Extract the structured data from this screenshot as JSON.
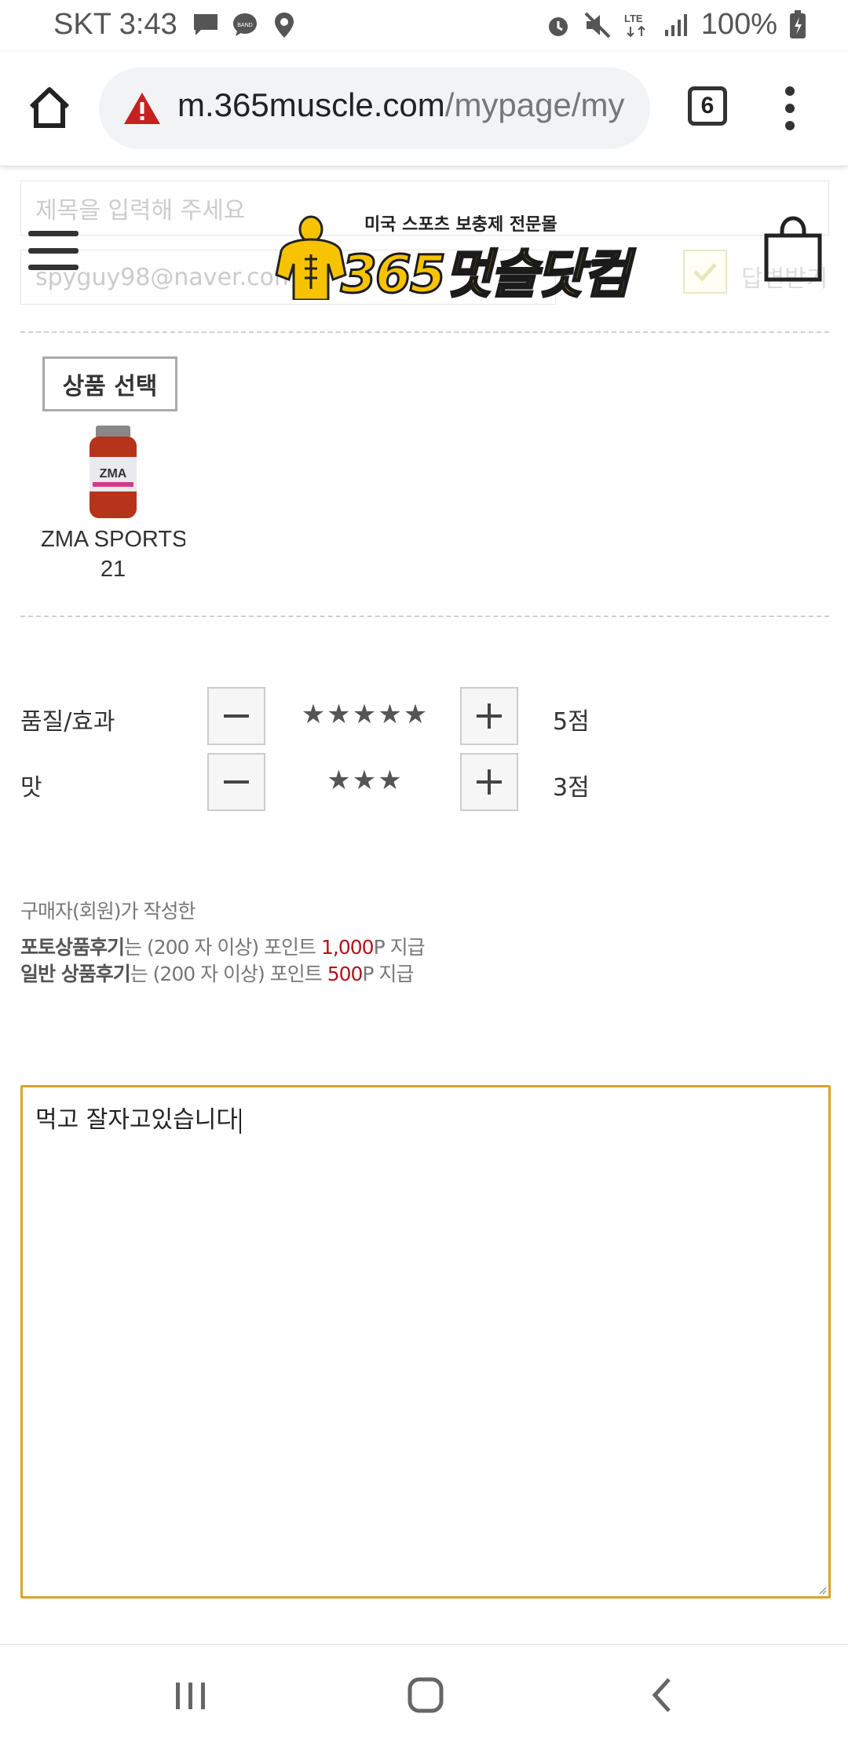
{
  "status_bar": {
    "carrier_time": "SKT 3:43",
    "notification_icons": [
      "message-icon",
      "band-icon",
      "location-icon"
    ],
    "band_label": "BAND",
    "system_icons": [
      "alarm-icon",
      "mute-icon",
      "lte-icon",
      "signal-icon"
    ],
    "lte_label": "LTE",
    "battery": "100%"
  },
  "browser": {
    "url_host": "m.365muscle.com",
    "url_path": "/mypage/my",
    "tab_count": "6",
    "security_state": "not-secure"
  },
  "site": {
    "logo_tagline": "미국 스포츠 보충제 전문몰",
    "logo_brand": "365멋슬닷컴"
  },
  "form": {
    "title_placeholder": "제목을 입력해 주세요",
    "email_value": "spyguy98@naver.com",
    "reply_checkbox_label": "답변받기",
    "product_select_label": "상품 선택",
    "product_name": "ZMA SPORTS",
    "product_name_line2": "21",
    "ratings": [
      {
        "label": "품질/효과",
        "stars": "★★★★★",
        "score": "5점",
        "value": 5
      },
      {
        "label": "맛",
        "stars": "★★★",
        "score": "3점",
        "value": 3
      }
    ],
    "notice": {
      "line1": "구매자(회원)가 작성한",
      "line2_bold": "포토상품후기",
      "line2_mid": "는 (200 자 이상) 포인트 ",
      "line2_points": "1,000",
      "line2_end": "P 지급",
      "line3_bold": "일반 상품후기",
      "line3_mid": "는 (200 자 이상) 포인트 ",
      "line3_points": "500",
      "line3_end": "P 지급"
    },
    "review_text": "먹고 잘자고있습니다"
  },
  "colors": {
    "accent_gold": "#d9a528",
    "points_red": "#b0141a",
    "logo_yellow": "#f7c300"
  }
}
